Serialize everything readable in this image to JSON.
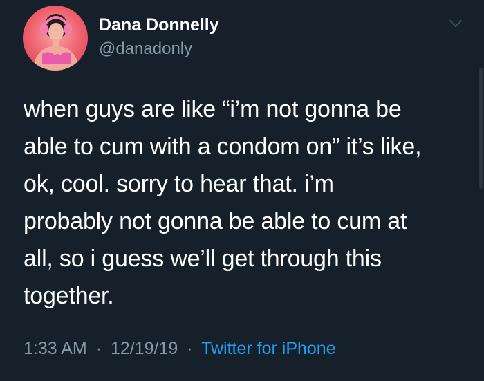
{
  "user": {
    "display_name": "Dana Donnelly",
    "handle": "@danadonly"
  },
  "tweet": {
    "lines": [
      "when guys are like “i’m not gonna be",
      "able to cum with a condom on” it’s like,",
      "ok, cool. sorry to hear that. i’m",
      "probably not gonna be able to cum at",
      "all, so i guess we’ll get through this",
      "together."
    ]
  },
  "meta": {
    "time": "1:33 AM",
    "separator": "·",
    "date": "12/19/19",
    "source": "Twitter for iPhone"
  },
  "icons": {
    "menu": "chevron-down-icon",
    "avatar": "profile-photo"
  },
  "colors": {
    "background": "#15202b",
    "text": "#ffffff",
    "secondary": "#8899a6",
    "link": "#1da1f2"
  }
}
